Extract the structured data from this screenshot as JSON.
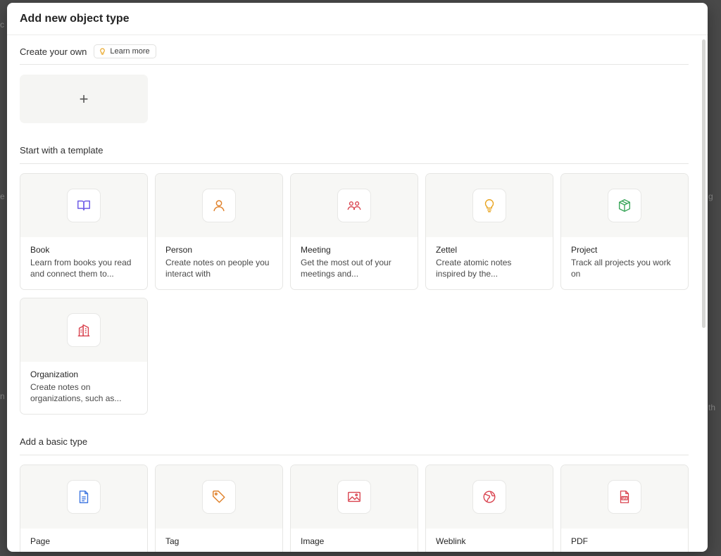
{
  "modal": {
    "title": "Add new object type"
  },
  "create_your_own": {
    "title": "Create your own",
    "learn_more": "Learn more",
    "add_tile": "+"
  },
  "templates": {
    "title": "Start with a template",
    "items": [
      {
        "name": "Book",
        "description": "Learn from books you read and connect them to...",
        "icon": "book-icon",
        "color": "#6e5ce6"
      },
      {
        "name": "Person",
        "description": "Create notes on people you interact with",
        "icon": "person-icon",
        "color": "#e0822c"
      },
      {
        "name": "Meeting",
        "description": "Get the most out of your meetings and...",
        "icon": "people-group-icon",
        "color": "#d9424e"
      },
      {
        "name": "Zettel",
        "description": "Create atomic notes inspired by the...",
        "icon": "lightbulb-icon",
        "color": "#e8a21c"
      },
      {
        "name": "Project",
        "description": "Track all projects you work on",
        "icon": "box-icon",
        "color": "#3aa65a"
      },
      {
        "name": "Organization",
        "description": "Create notes on organizations, such as...",
        "icon": "building-icon",
        "color": "#d9424e"
      }
    ]
  },
  "basic_types": {
    "title": "Add a basic type",
    "items": [
      {
        "name": "Page",
        "icon": "document-icon",
        "color": "#3b74e0"
      },
      {
        "name": "Tag",
        "icon": "tag-icon",
        "color": "#e0822c"
      },
      {
        "name": "Image",
        "icon": "image-icon",
        "color": "#d9424e"
      },
      {
        "name": "Weblink",
        "icon": "globe-icon",
        "color": "#d9424e"
      },
      {
        "name": "PDF",
        "icon": "pdf-icon",
        "color": "#d9424e"
      }
    ]
  }
}
